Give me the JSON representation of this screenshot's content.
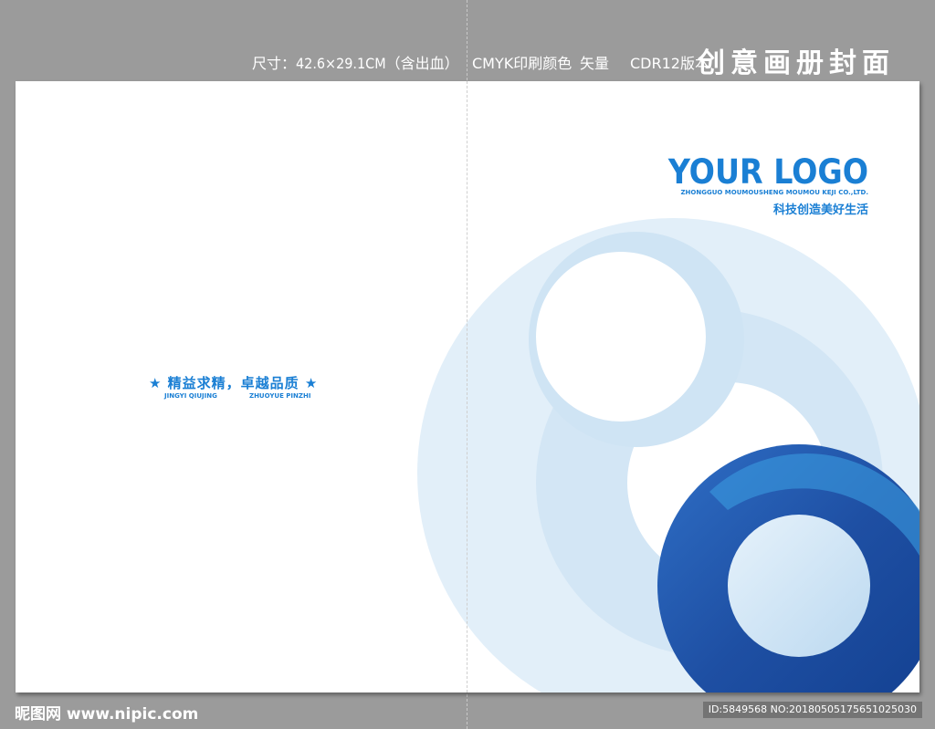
{
  "spec_line": {
    "size": "尺寸：42.6×29.1CM（含出血）",
    "color_mode": "CMYK印刷颜色",
    "vector": "矢量",
    "version": "CDR12版本",
    "title": "创意画册封面"
  },
  "front_cover": {
    "logo": "YOUR LOGO",
    "company": "ZHONGGUO MOUMOUSHENG MOUMOU KEJI CO.,LTD.",
    "slogan": "科技创造美好生活"
  },
  "back_cover": {
    "slogan": "★ 精益求精，卓越品质 ★",
    "pinyin_left": "JINGYI QIUJING",
    "pinyin_right": "ZHUOYUE PINZHI"
  },
  "watermark": {
    "site": "昵图网 www.nipic.com",
    "id": "ID:5849568 NO:20180505175651025030"
  },
  "colors": {
    "background": "#9b9b9b",
    "brand_blue": "#1a7fd4",
    "ring_dark": "#1e4fa3",
    "ring_light": "#d7e9f6"
  }
}
